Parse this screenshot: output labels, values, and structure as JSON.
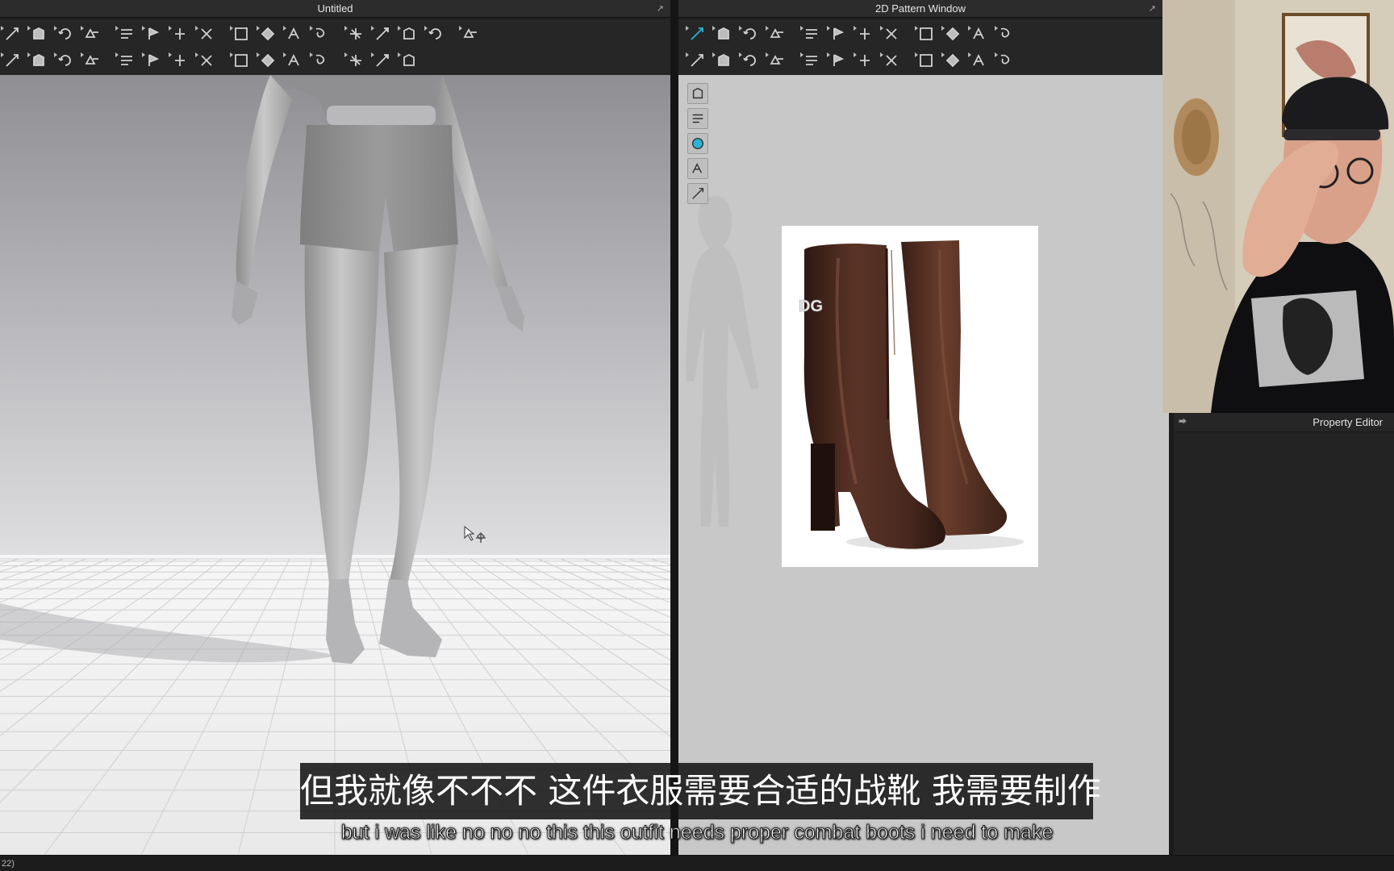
{
  "window_3d": {
    "title": "Untitled",
    "restore_icon": "restore-icon"
  },
  "window_2d": {
    "title": "2D Pattern Window",
    "restore_icon": "restore-icon"
  },
  "property_editor": {
    "title": "Property Editor"
  },
  "status_bar": {
    "text": "22)"
  },
  "subtitles": {
    "chinese": "但我就像不不不 这件衣服需要合适的战靴 我需要制作",
    "english": "but i was like no no no this this outfit needs proper combat boots i need to make"
  },
  "reference_image": {
    "logo_text": "DG",
    "subject": "brown-leather-heeled-ankle-boots"
  },
  "toolbar_3d": {
    "row1": [
      "edit-pattern-icon",
      "garment-icon",
      "rotate-icon",
      "arrange-icon",
      "fold-icon",
      "fold-arrange-icon",
      "tack-icon",
      "pin-icon",
      "select-mesh-icon",
      "symmetry-icon",
      "book-icon",
      "avatar-measure-icon",
      "transform-icon",
      "seam-line-icon",
      "pen-icon",
      "undo-3d-icon",
      "shirt-fill-icon"
    ],
    "row2": [
      "sew-icon",
      "segment-sew-icon",
      "free-sew-icon",
      "multi-sew-icon",
      "trim-icon",
      "puckering-icon",
      "knit-icon",
      "button-icon",
      "buttonhole-icon",
      "zipper-icon",
      "elastic-icon",
      "shrinkage-icon",
      "texture-icon",
      "graphic-icon",
      "split-icon"
    ]
  },
  "toolbar_2d": {
    "row1": [
      "transform-pattern-icon",
      "edit-point-icon",
      "curve-icon",
      "rectangle-icon",
      "polygon-icon",
      "internal-rect-icon",
      "dart-icon",
      "cut-icon",
      "trace-icon",
      "tape-icon",
      "notch-icon",
      "ruler-icon"
    ],
    "row2": [
      "segment-sew-2d-icon",
      "free-sew-2d-icon",
      "seam-taping-icon",
      "check-sew-icon",
      "iron-icon",
      "garment-2d-icon",
      "fold-2d-icon",
      "pleat-icon",
      "pleat-fold-icon",
      "line-icon",
      "topstitch-icon",
      "zigzag-icon"
    ]
  },
  "side_tools": [
    "brush-icon",
    "shirt-view-icon",
    "info-icon",
    "texture-view-icon",
    "lock-shirt-icon"
  ],
  "colors": {
    "accent": "#2ab4d8",
    "panel_dark": "#262626",
    "boot_brown": "#4a2a20"
  }
}
